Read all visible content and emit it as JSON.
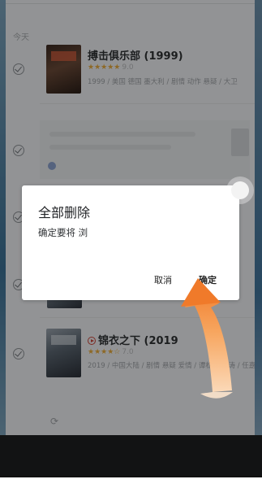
{
  "history": {
    "section_label": "今天",
    "items": [
      {
        "title": "搏击俱乐部 (1999)",
        "stars": "★★★★★",
        "score": "9.0",
        "meta": "1999 / 美国 德国 墨大利 / 剧情 动作 悬疑 / 大卫"
      },
      {
        "title": "锦衣之下 (2019",
        "stars": "★★★★☆",
        "score": "7.0",
        "meta": "2019 / 中国大陆 / 剧情 悬疑 爱情 / 谭松韵 尹涛 / 任嘉伦"
      }
    ]
  },
  "dialog": {
    "title": "全部删除",
    "message": "确定要将 浏",
    "cancel_label": "取消",
    "ok_label": "确定"
  },
  "colors": {
    "accent_arrow": "#f58a3c",
    "star": "#e4a83c",
    "overlay": "rgba(0,0,0,0.38)"
  },
  "icons": [
    "check-circle-icon",
    "play-circle-icon",
    "refresh-icon",
    "touch-indicator-icon",
    "curved-arrow-icon"
  ]
}
